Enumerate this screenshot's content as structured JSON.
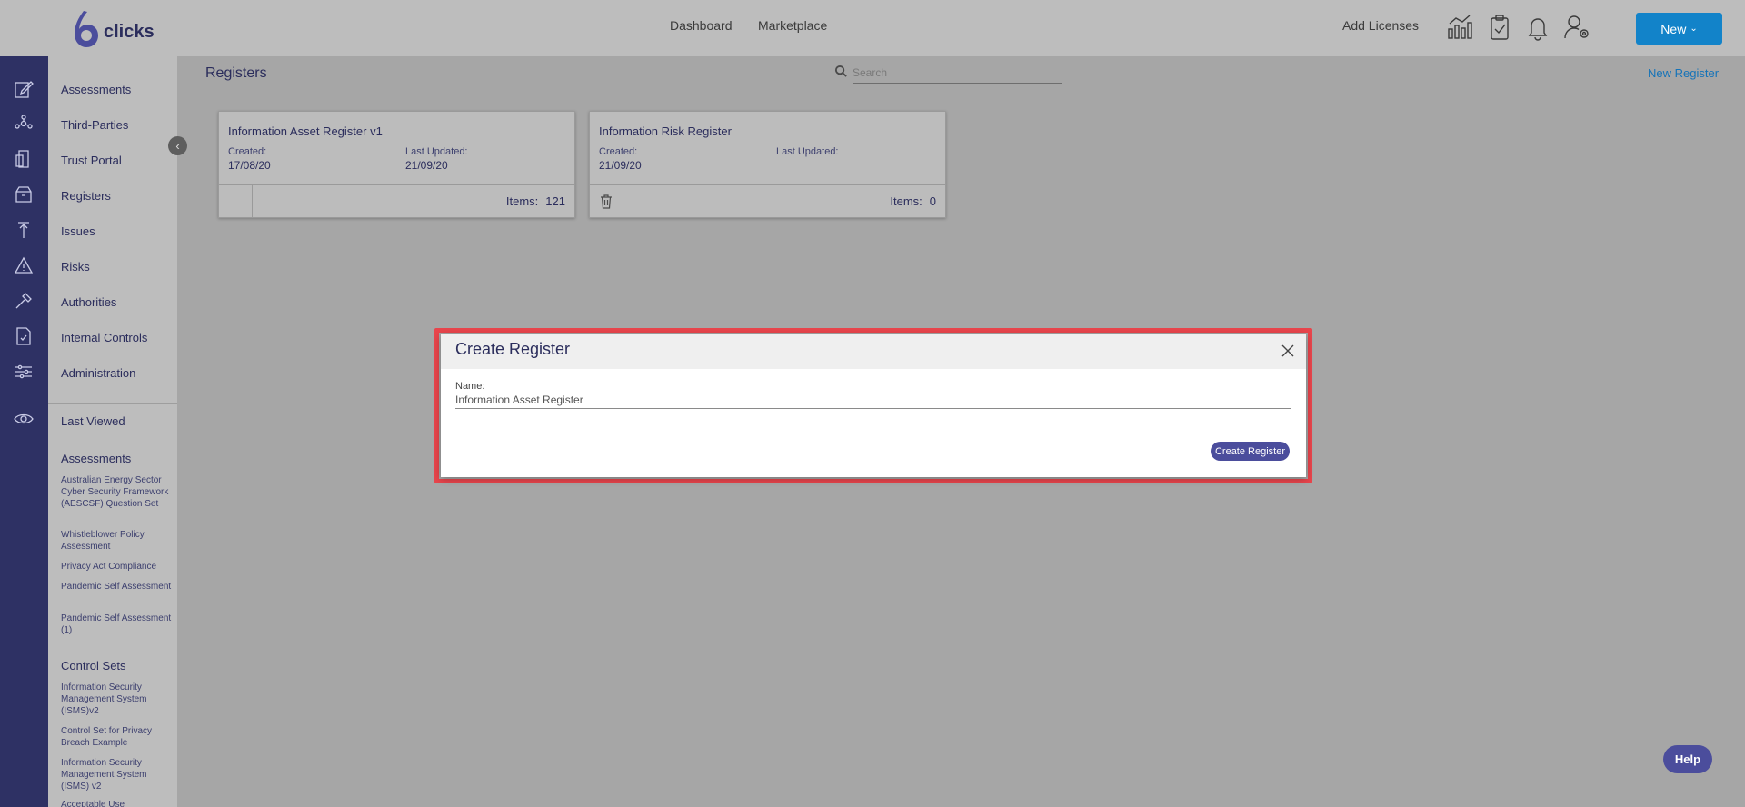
{
  "app": {
    "logo_text": "clicks"
  },
  "header": {
    "nav": [
      "Dashboard",
      "Marketplace"
    ],
    "add_licenses": "Add Licenses",
    "icons": [
      "analytics-icon",
      "clipboard-check-icon",
      "bell-icon",
      "user-settings-icon"
    ],
    "new_button": "New"
  },
  "rail": {
    "icons": [
      "assessments-icon",
      "third-parties-icon",
      "trust-portal-icon",
      "registers-icon",
      "issues-icon",
      "risks-icon",
      "authorities-icon",
      "internal-controls-icon",
      "administration-icon",
      "last-viewed-eye-icon"
    ]
  },
  "sidebar": {
    "items": [
      "Assessments",
      "Third-Parties",
      "Trust Portal",
      "Registers",
      "Issues",
      "Risks",
      "Authorities",
      "Internal Controls",
      "Administration"
    ],
    "last_viewed": "Last Viewed",
    "assessments_heading": "Assessments",
    "assessments": [
      "Australian Energy Sector Cyber Security Framework (AESCSF) Question Set",
      "Whistleblower Policy Assessment",
      "Privacy Act Compliance",
      "Pandemic Self Assessment",
      "Pandemic Self Assessment (1)"
    ],
    "control_sets_heading": "Control Sets",
    "control_sets": [
      "Information Security Management System (ISMS)v2",
      "Control Set for Privacy Breach Example",
      "Information Security Management System (ISMS) v2",
      "Acceptable Use"
    ]
  },
  "main": {
    "title": "Registers",
    "search_placeholder": "Search",
    "new_register": "New Register",
    "cards": [
      {
        "title": "Information Asset Register v1",
        "created_label": "Created:",
        "created": "17/08/20",
        "updated_label": "Last Updated:",
        "updated": "21/09/20",
        "items_label": "Items:",
        "items": "121"
      },
      {
        "title": "Information Risk Register",
        "created_label": "Created:",
        "created": "21/09/20",
        "updated_label": "Last Updated:",
        "updated": "",
        "items_label": "Items:",
        "items": "0"
      }
    ]
  },
  "modal": {
    "title": "Create Register",
    "name_label": "Name:",
    "name_value": "Information Asset Register",
    "submit": "Create Register"
  },
  "help": "Help",
  "colors": {
    "rail": "#2e3164",
    "accent": "#1283c9",
    "primary_button": "#4b4d9c",
    "highlight": "#e8454c"
  }
}
